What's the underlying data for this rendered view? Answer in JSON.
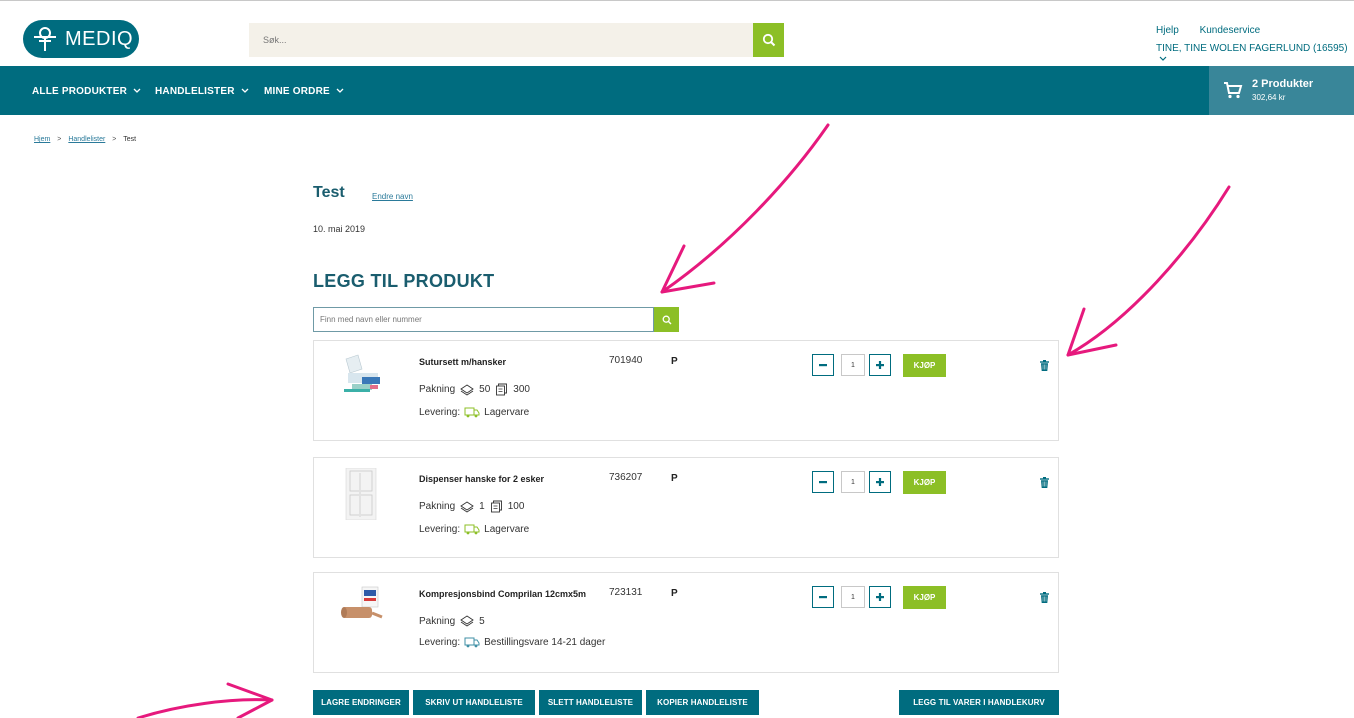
{
  "header": {
    "logo_text": "MEDIQ",
    "search_placeholder": "Søk...",
    "help": "Hjelp",
    "customer_service": "Kundeservice",
    "account": "TINE, TINE WOLEN FAGERLUND (16595)"
  },
  "nav": {
    "items": [
      {
        "label": "ALLE PRODUKTER"
      },
      {
        "label": "HANDLELISTER"
      },
      {
        "label": "MINE ORDRE"
      }
    ],
    "cart_count": "2 Produkter",
    "cart_total": "302,64 kr"
  },
  "breadcrumb": {
    "home": "Hjem",
    "lists": "Handlelister",
    "current": "Test"
  },
  "list": {
    "title": "Test",
    "rename": "Endre navn",
    "date": "10. mai 2019",
    "section_title": "LEGG TIL PRODUKT",
    "product_search_placeholder": "Finn med navn eller nummer"
  },
  "labels": {
    "packing": "Pakning",
    "delivery": "Levering:",
    "buy": "KJØP"
  },
  "products": [
    {
      "name": "Sutursett m/hansker",
      "sku": "701940",
      "flag": "P",
      "pack_qty": "50",
      "pack_total": "300",
      "delivery": "Lagervare",
      "qty": "1"
    },
    {
      "name": "Dispenser hanske for 2 esker",
      "sku": "736207",
      "flag": "P",
      "pack_qty": "1",
      "pack_total": "100",
      "delivery": "Lagervare",
      "qty": "1"
    },
    {
      "name": "Kompresjonsbind Comprilan 12cmx5m",
      "sku": "723131",
      "flag": "P",
      "pack_qty": "5",
      "pack_total": "",
      "delivery": "Bestillingsvare 14-21 dager",
      "qty": "1"
    }
  ],
  "actions": {
    "save": "LAGRE ENDRINGER",
    "print": "SKRIV UT HANDLELISTE",
    "delete": "SLETT HANDLELISTE",
    "copy": "KOPIER HANDLELISTE",
    "add_to_cart": "LEGG TIL VARER I HANDLEKURV"
  },
  "colors": {
    "brand_teal": "#006c7f",
    "accent_green": "#8cbf26",
    "annotation_pink": "#e6197d"
  }
}
